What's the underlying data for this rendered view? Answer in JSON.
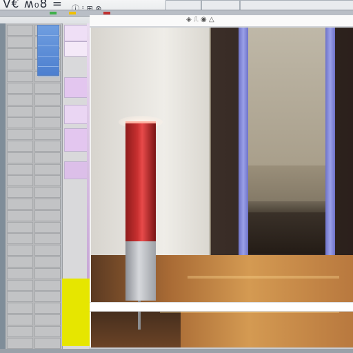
{
  "toolbar": {
    "title_glyphs": "V€ ʍ₀8 =",
    "icon_glyphs": "ⓘ ⁝ ⊞ ⊗",
    "tabs": [
      "",
      "",
      ""
    ]
  },
  "viewport": {
    "header_icons": "◈ ⎍ ◉ △",
    "colors": {
      "lamp_red": "#c93030",
      "post_blue": "#8f95e0",
      "floor_wood": "#c68a46",
      "highlight_yellow": "#e6e600"
    }
  },
  "sheet": {
    "rows": 28,
    "accent_colors": [
      "#6f9ee0",
      "#e3c6ef",
      "#e6e600"
    ]
  }
}
